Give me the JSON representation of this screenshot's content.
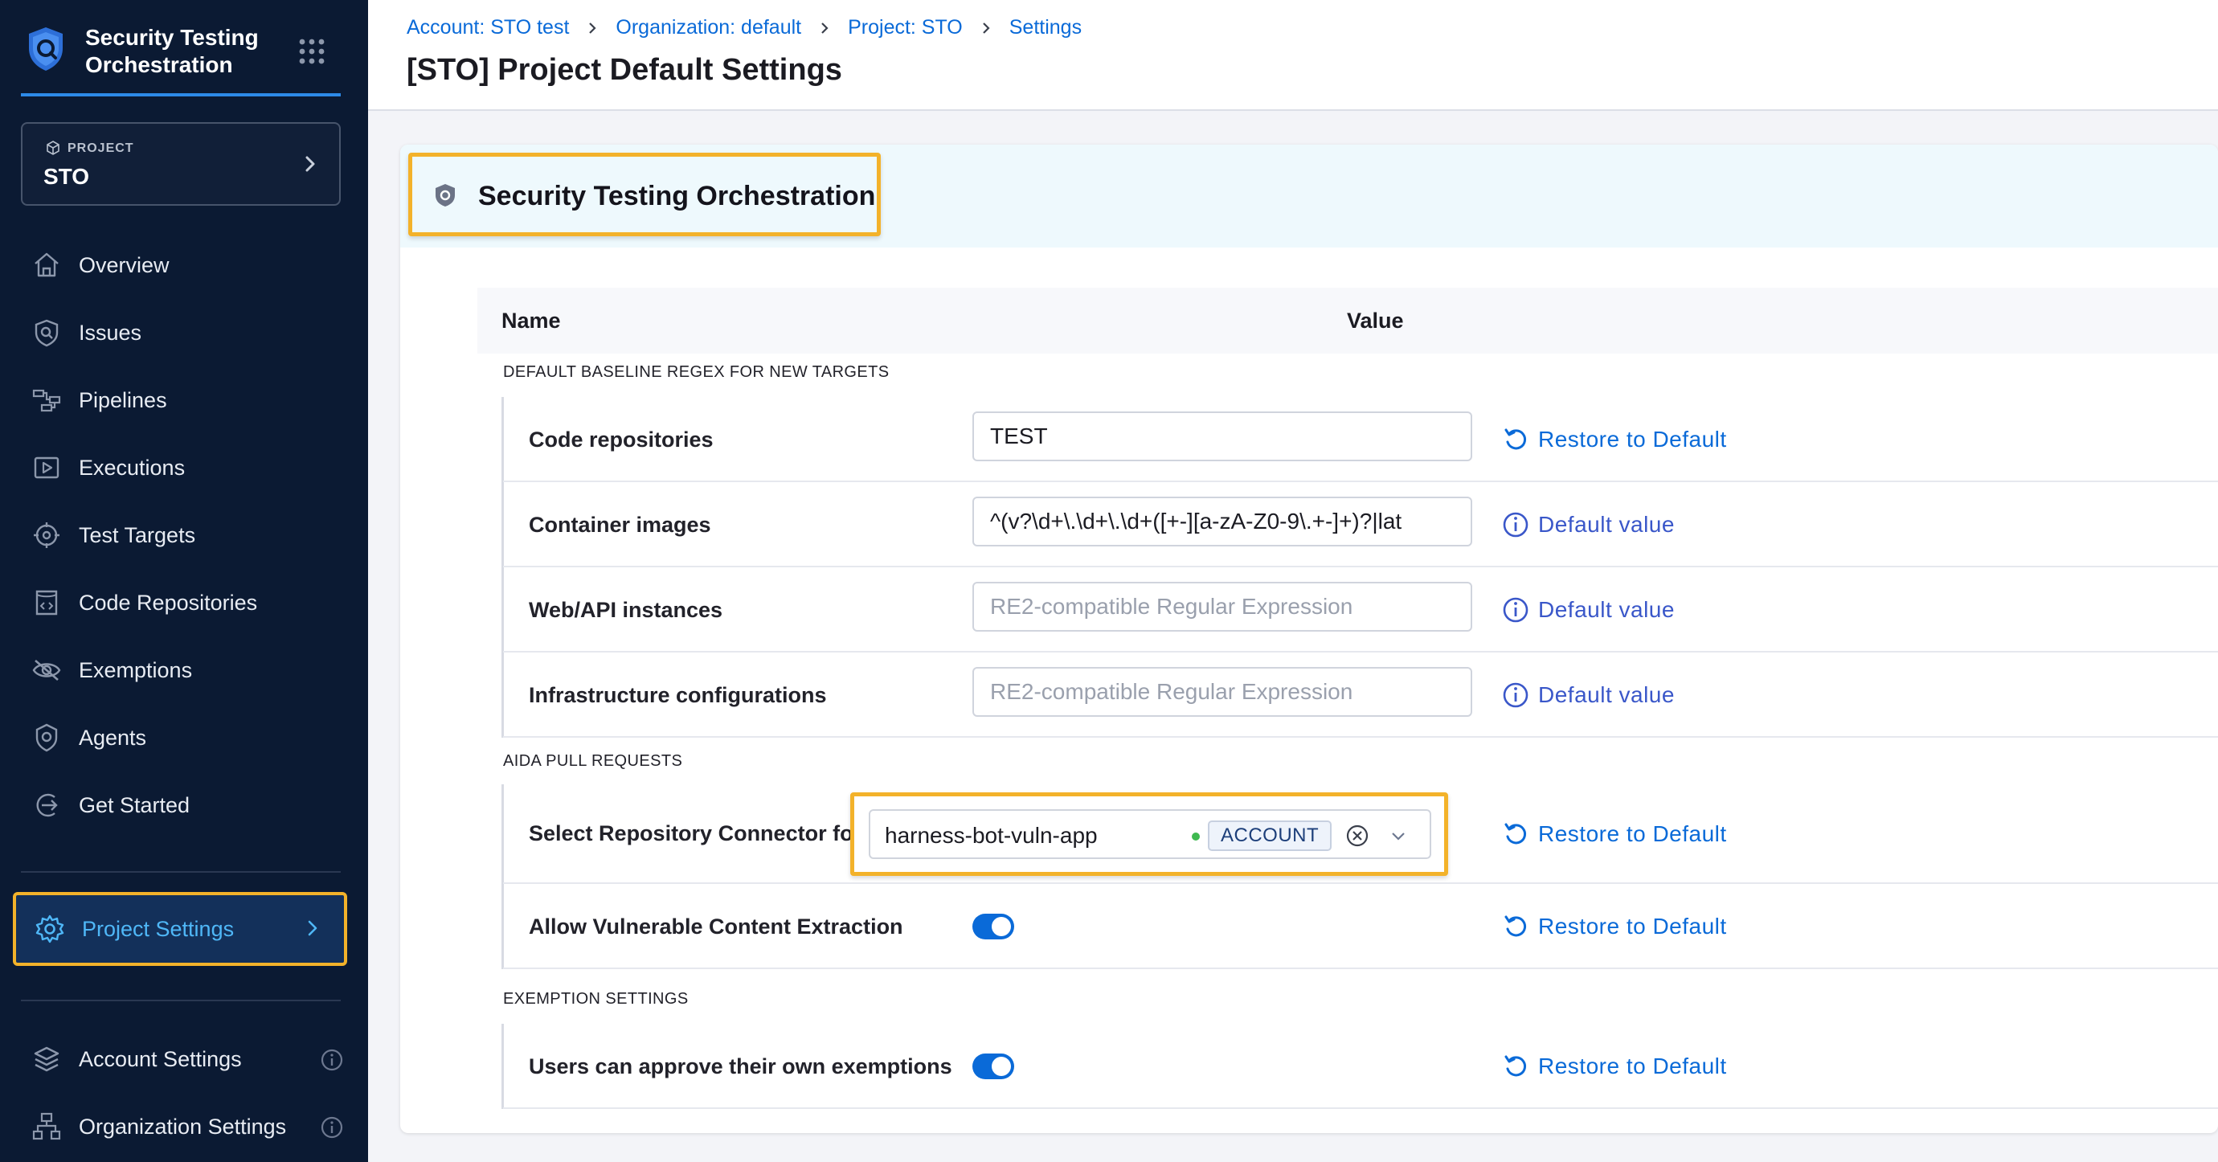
{
  "app": {
    "title": "Security Testing Orchestration",
    "project_label": "PROJECT",
    "project_name": "STO"
  },
  "sidebar": {
    "items": [
      {
        "label": "Overview",
        "icon": "home-icon"
      },
      {
        "label": "Issues",
        "icon": "issues-icon"
      },
      {
        "label": "Pipelines",
        "icon": "pipelines-icon"
      },
      {
        "label": "Executions",
        "icon": "executions-icon"
      },
      {
        "label": "Test Targets",
        "icon": "target-icon"
      },
      {
        "label": "Code Repositories",
        "icon": "code-repo-icon"
      },
      {
        "label": "Exemptions",
        "icon": "eye-off-icon"
      },
      {
        "label": "Agents",
        "icon": "agent-icon"
      },
      {
        "label": "Get Started",
        "icon": "get-started-icon"
      }
    ],
    "project_settings": "Project Settings",
    "account_settings": "Account Settings",
    "organization_settings": "Organization Settings"
  },
  "header": {
    "breadcrumbs": [
      "Account: STO test",
      "Organization: default",
      "Project: STO",
      "Settings"
    ],
    "title": "[STO] Project Default Settings"
  },
  "section": {
    "title": "Security Testing Orchestration",
    "columns": {
      "name": "Name",
      "value": "Value"
    }
  },
  "groups": {
    "baseline": {
      "label": "DEFAULT BASELINE REGEX FOR NEW TARGETS",
      "rows": [
        {
          "name": "Code repositories",
          "value": "TEST",
          "placeholder": "",
          "action": "Restore to Default"
        },
        {
          "name": "Container images",
          "value": "^(v?\\d+\\.\\d+\\.\\d+([+-][a-zA-Z0-9\\.+-]+)?|lat",
          "placeholder": "",
          "action": "Default value"
        },
        {
          "name": "Web/API instances",
          "value": "",
          "placeholder": "RE2-compatible Regular Expression",
          "action": "Default value"
        },
        {
          "name": "Infrastructure configurations",
          "value": "",
          "placeholder": "RE2-compatible Regular Expression",
          "action": "Default value"
        }
      ]
    },
    "aida": {
      "label": "AIDA PULL REQUESTS",
      "connector_row": {
        "name": "Select Repository Connector for Pull Requests",
        "value": "harness-bot-vuln-app",
        "badge": "ACCOUNT",
        "action": "Restore to Default"
      },
      "extraction_row": {
        "name": "Allow Vulnerable Content Extraction",
        "enabled": true,
        "action": "Restore to Default"
      }
    },
    "exemption": {
      "label": "EXEMPTION SETTINGS",
      "row": {
        "name": "Users can approve their own exemptions",
        "enabled": true,
        "action": "Restore to Default"
      }
    }
  },
  "colors": {
    "sidebar_bg": "#0b1a33",
    "accent_blue": "#0a6ad8",
    "highlight": "#f3b22a",
    "active_text": "#4fb7f7",
    "status_green": "#3fb950"
  }
}
